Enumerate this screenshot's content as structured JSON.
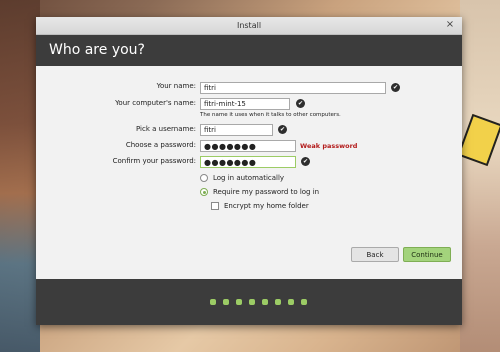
{
  "window": {
    "title": "Install",
    "close_icon": "×"
  },
  "header": {
    "title": "Who are you?"
  },
  "form": {
    "name_label": "Your name:",
    "name_value": "fitri",
    "computer_label": "Your computer's name:",
    "computer_value": "fitri-mint-15",
    "computer_hint": "The name it uses when it talks to other computers.",
    "username_label": "Pick a username:",
    "username_value": "fitri",
    "password_label": "Choose a password:",
    "password_value": "●●●●●●●",
    "password_strength": "Weak password",
    "confirm_label": "Confirm your password:",
    "confirm_value": "●●●●●●●",
    "check_glyph": "✔"
  },
  "options": {
    "login_auto": "Log in automatically",
    "require_password": "Require my password to log in",
    "encrypt_home": "Encrypt my home folder"
  },
  "buttons": {
    "back": "Back",
    "continue": "Continue"
  },
  "colors": {
    "accent": "#9ccc65",
    "warning": "#b31b1b",
    "header_bg": "#3c3c3c"
  }
}
